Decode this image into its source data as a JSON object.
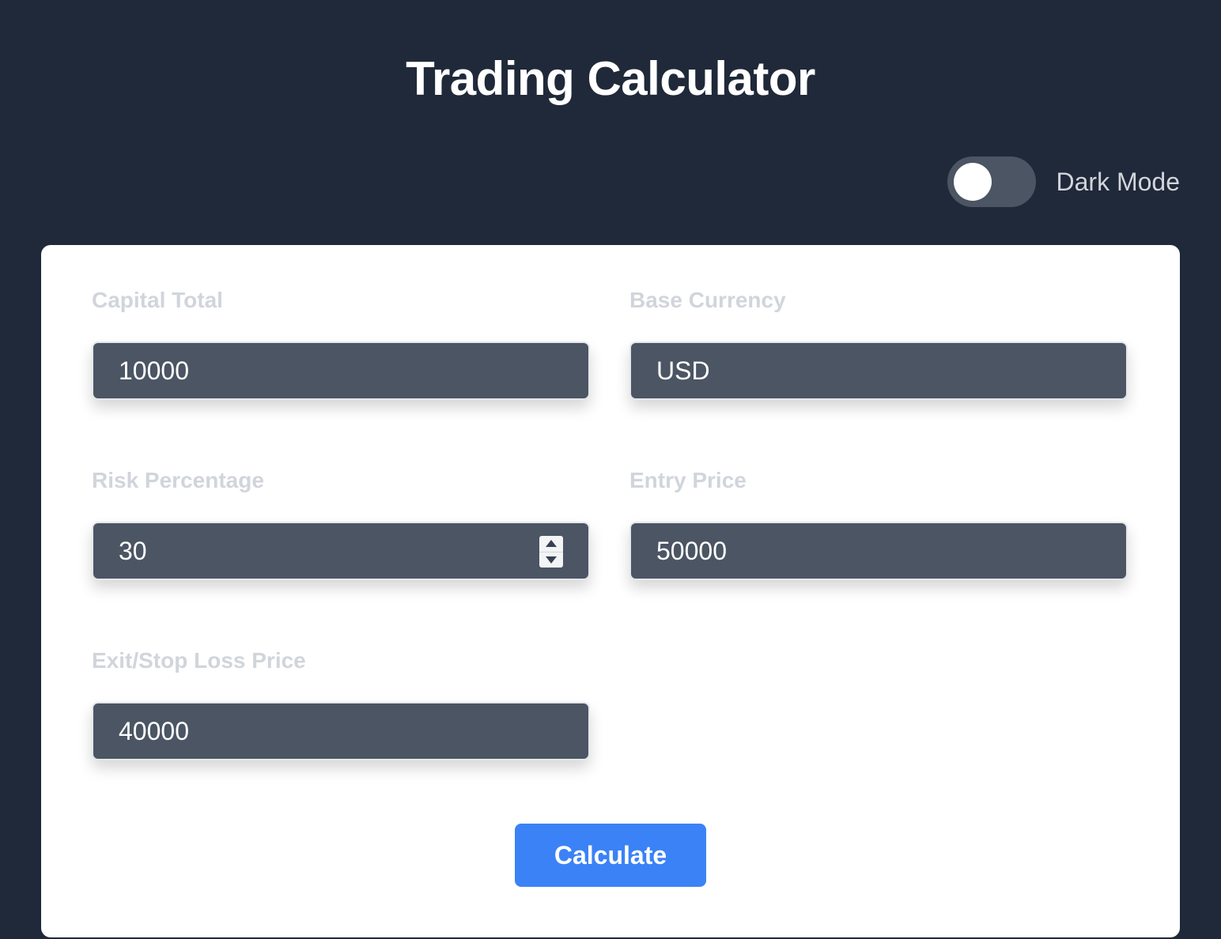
{
  "header": {
    "title": "Trading Calculator"
  },
  "theme_toggle": {
    "label": "Dark Mode",
    "enabled": false
  },
  "form": {
    "capital_total": {
      "label": "Capital Total",
      "value": "10000"
    },
    "base_currency": {
      "label": "Base Currency",
      "value": "USD"
    },
    "risk_percentage": {
      "label": "Risk Percentage",
      "value": "30"
    },
    "entry_price": {
      "label": "Entry Price",
      "value": "50000"
    },
    "exit_stop_loss_price": {
      "label": "Exit/Stop Loss Price",
      "value": "40000"
    },
    "submit_label": "Calculate"
  },
  "colors": {
    "background": "#202939",
    "card": "#ffffff",
    "input_bg": "#4b5563",
    "label": "#d1d5db",
    "accent": "#3b82f6"
  }
}
